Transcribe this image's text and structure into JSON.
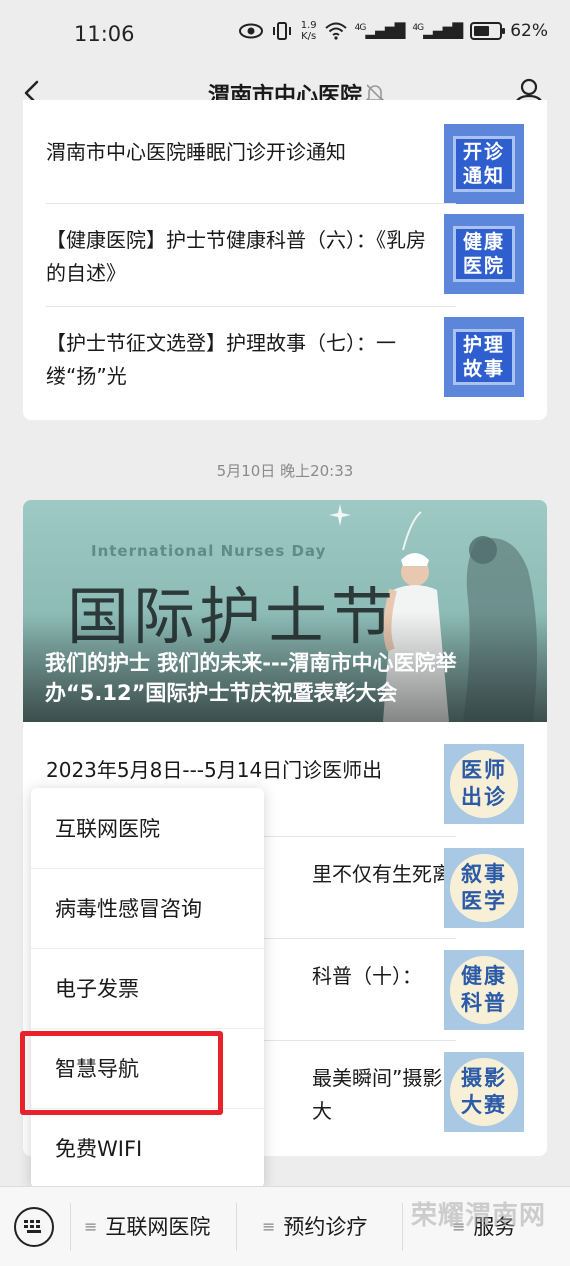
{
  "status_bar": {
    "time": "11:06",
    "net_speed_top": "1.9",
    "net_speed_bottom": "K/s",
    "signal_1": "4G",
    "signal_2": "4G",
    "battery": "62%",
    "battery_level": 0.62
  },
  "nav": {
    "title": "渭南市中心医院"
  },
  "card1": {
    "items": [
      {
        "text": "渭南市中心医院睡眠门诊开诊通知",
        "thumb": "开诊\n通知"
      },
      {
        "text": "【健康医院】护士节健康科普（六）：《乳房的自述》",
        "thumb": "健康\n医院"
      },
      {
        "text": "【护士节征文选登】护理故事（七）：一缕“扬”光",
        "thumb": "护理\n故事"
      }
    ]
  },
  "timestamp": "5月10日 晚上20:33",
  "card2": {
    "hero_en": "International Nurses Day",
    "hero_cn": "国际护士节",
    "hero_title": "我们的护士 我们的未来---渭南市中心医院举办“5.12”国际护士节庆祝暨表彰大会",
    "items": [
      {
        "text": "2023年5月8日---5月14日门诊医师出",
        "thumb": "医师\n出诊"
      },
      {
        "text": "里不仅有生死离",
        "thumb": "叙事\n医学"
      },
      {
        "text": "科普（十）：",
        "thumb": "健康\n科普"
      },
      {
        "text": "最美瞬间”摄影大",
        "thumb": "摄影\n大赛"
      }
    ]
  },
  "popup_menu": {
    "items": [
      "互联网医院",
      "病毒性感冒咨询",
      "电子发票",
      "智慧导航",
      "免费WIFI"
    ]
  },
  "bottom_bar": {
    "items": [
      "互联网医院",
      "预约诊疗",
      "服务"
    ],
    "watermark": "荣耀渭南网"
  }
}
